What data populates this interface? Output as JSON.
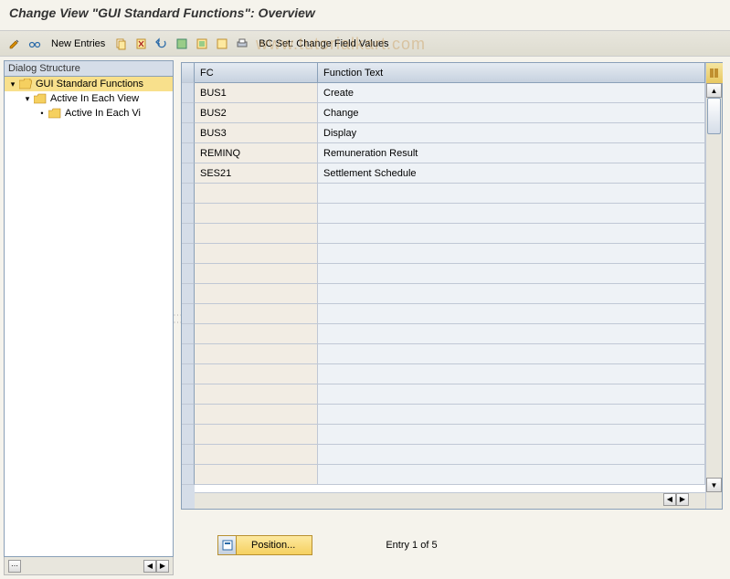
{
  "title": "Change View \"GUI Standard Functions\": Overview",
  "toolbar": {
    "new_entries_label": "New Entries",
    "bc_set_label": "BC Set: Change Field Values"
  },
  "watermark": "www.tutorialkart.com",
  "sidebar": {
    "header": "Dialog Structure",
    "tree": {
      "root": {
        "label": "GUI Standard Functions"
      },
      "child1": {
        "label": "Active In Each View"
      },
      "child2": {
        "label": "Active In Each Vi"
      }
    }
  },
  "table": {
    "columns": {
      "fc": "FC",
      "ft": "Function Text"
    },
    "rows": [
      {
        "fc": "BUS1",
        "ft": "Create"
      },
      {
        "fc": "BUS2",
        "ft": "Change"
      },
      {
        "fc": "BUS3",
        "ft": "Display"
      },
      {
        "fc": "REMINQ",
        "ft": "Remuneration Result"
      },
      {
        "fc": "SES21",
        "ft": "Settlement Schedule"
      }
    ]
  },
  "footer": {
    "position_label": "Position...",
    "entry_label": "Entry 1 of 5"
  }
}
